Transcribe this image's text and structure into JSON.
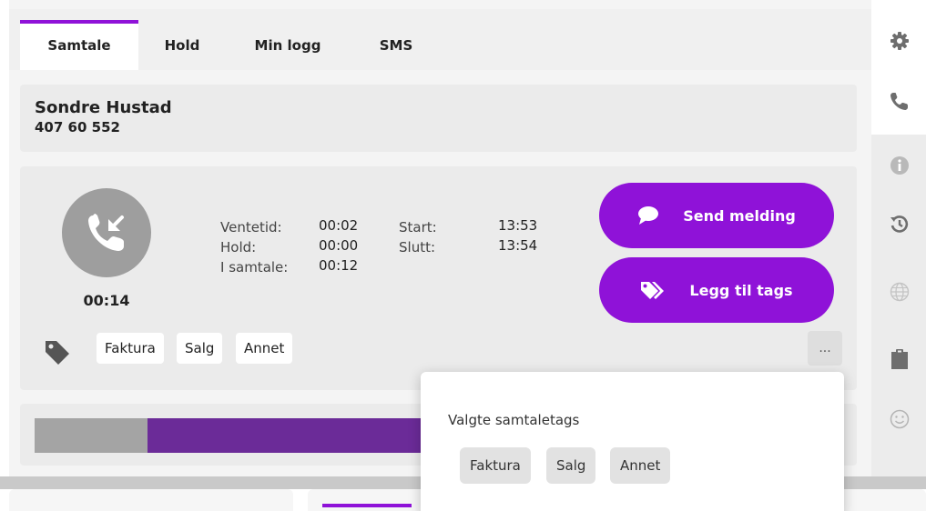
{
  "tabs": [
    {
      "label": "Samtale",
      "active": true
    },
    {
      "label": "Hold",
      "active": false
    },
    {
      "label": "Min logg",
      "active": false
    },
    {
      "label": "SMS",
      "active": false
    }
  ],
  "contact": {
    "name": "Sondre Hustad",
    "number": "407 60 552"
  },
  "call": {
    "duration": "00:14",
    "stats_left": [
      {
        "label": "Ventetid:",
        "value": "00:02"
      },
      {
        "label": "Hold:",
        "value": "00:00"
      },
      {
        "label": "I samtale:",
        "value": "00:12"
      }
    ],
    "stats_right": [
      {
        "label": "Start:",
        "value": "13:53"
      },
      {
        "label": "Slutt:",
        "value": "13:54"
      }
    ]
  },
  "actions": {
    "send_message": "Send melding",
    "add_tags": "Legg til tags"
  },
  "tags": [
    "Faktura",
    "Salg",
    "Annet"
  ],
  "more_label": "...",
  "progress": {
    "fraction_completed": 0.14
  },
  "popover": {
    "title": "Valgte samtaletags",
    "tags": [
      "Faktura",
      "Salg",
      "Annet"
    ]
  },
  "colors": {
    "accent": "#8f12d8",
    "progress_remaining": "#6b2b98",
    "progress_done": "#a4a4a4"
  },
  "sidebar_icons": [
    "gear-icon",
    "phone-icon",
    "info-icon",
    "history-icon",
    "globe-icon",
    "clipboard-icon",
    "smiley-icon"
  ]
}
